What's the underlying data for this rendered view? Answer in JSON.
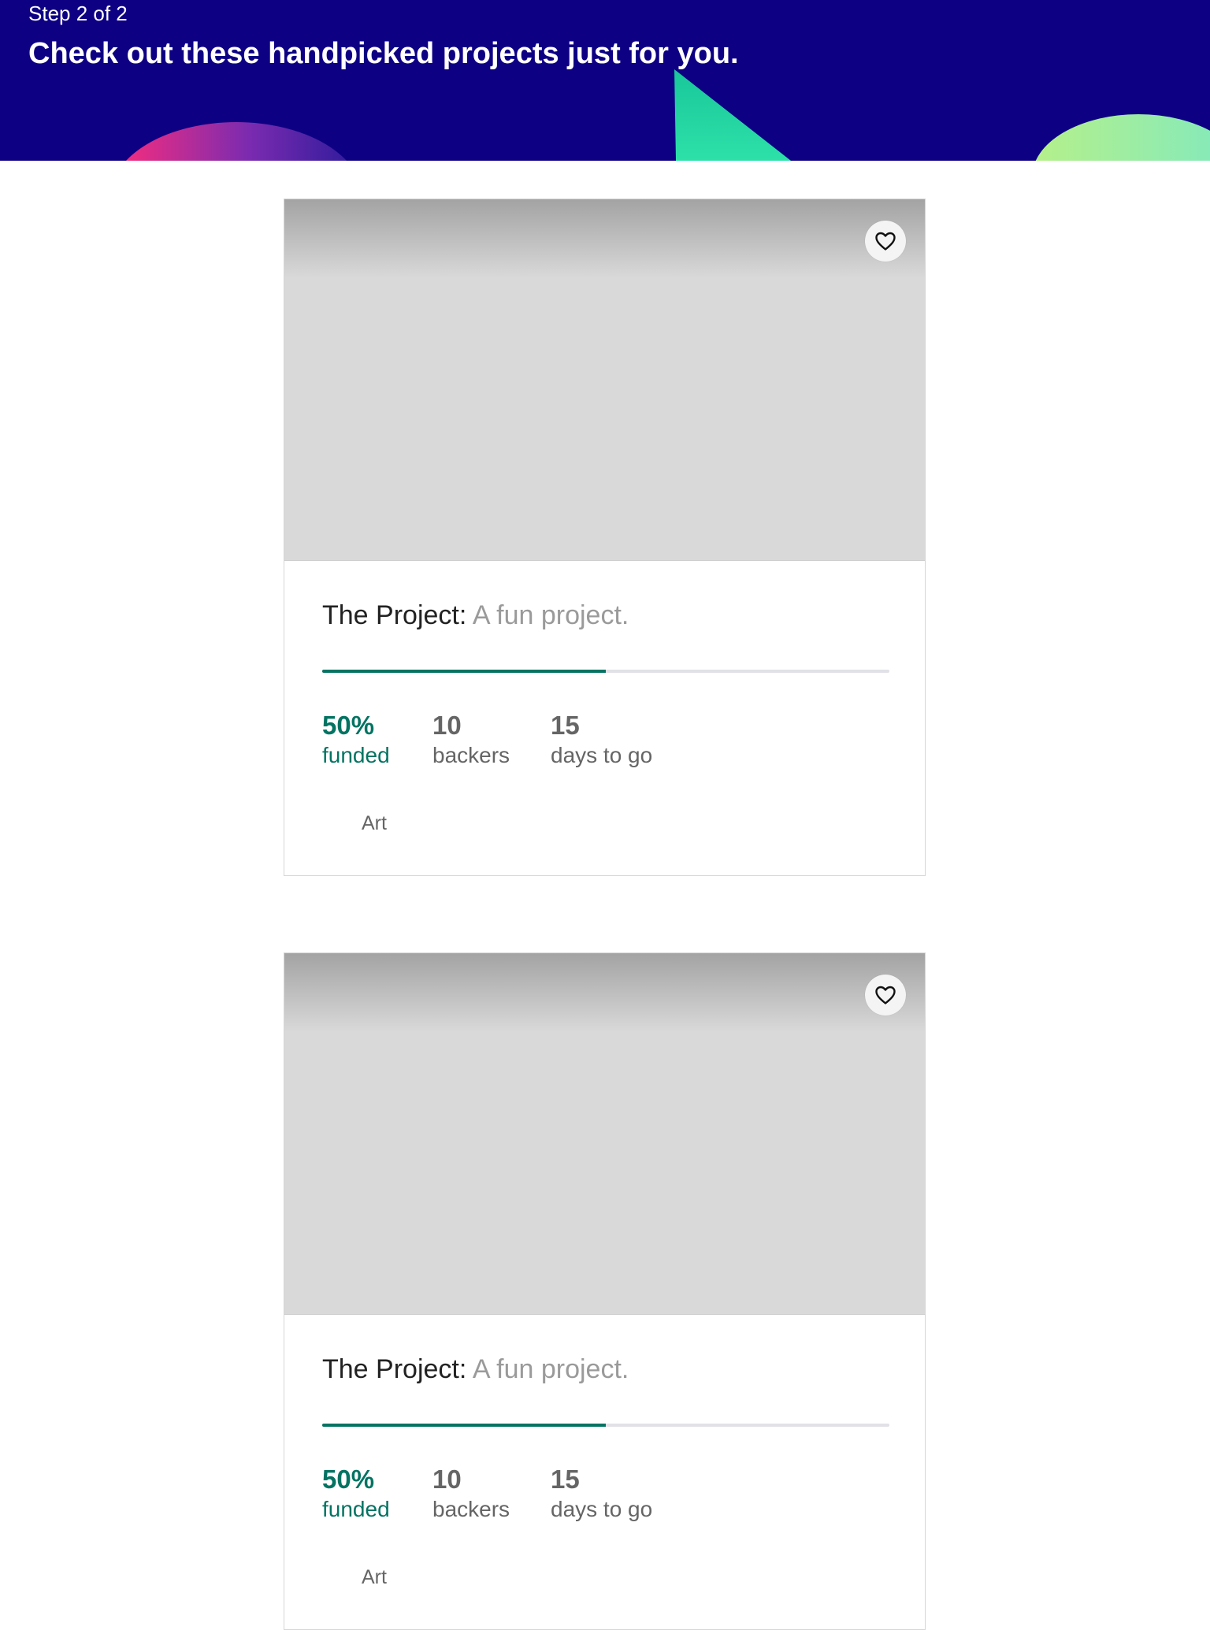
{
  "header": {
    "step": "Step 2 of 2",
    "headline": "Check out these handpicked projects just for you.",
    "background_color": "#0e0083"
  },
  "projects": [
    {
      "name": "The Project:",
      "blurb": "A fun project.",
      "percent_funded": "50%",
      "funded_label": "funded",
      "funded_fraction": 0.5,
      "backers_count": "10",
      "backers_label": "backers",
      "days_count": "15",
      "days_label": "days to go",
      "category": "Art",
      "save_icon": "heart-icon"
    },
    {
      "name": "The Project:",
      "blurb": "A fun project.",
      "percent_funded": "50%",
      "funded_label": "funded",
      "funded_fraction": 0.5,
      "backers_count": "10",
      "backers_label": "backers",
      "days_count": "15",
      "days_label": "days to go",
      "category": "Art",
      "save_icon": "heart-icon"
    }
  ],
  "colors": {
    "accent": "#037362",
    "muted_text": "#656565",
    "placeholder_image": "#d9d9d9"
  }
}
